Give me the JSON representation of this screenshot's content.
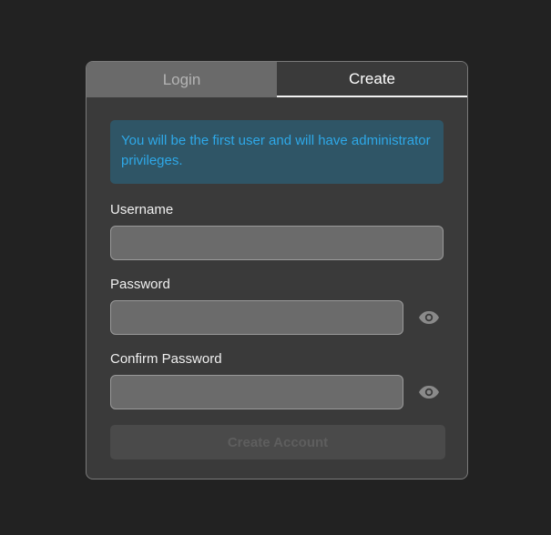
{
  "tabs": {
    "login": "Login",
    "create": "Create",
    "active": "create"
  },
  "alert": {
    "message": "You will be the first user and will have administrator privileges."
  },
  "fields": {
    "username_label": "Username",
    "username_value": "",
    "password_label": "Password",
    "password_value": "",
    "confirm_label": "Confirm Password",
    "confirm_value": ""
  },
  "icons": {
    "password_toggle": "eye-icon",
    "confirm_toggle": "eye-icon"
  },
  "submit": {
    "label": "Create Account",
    "enabled": false
  },
  "colors": {
    "alert_text": "#2ea8e8",
    "alert_bg": "#2f5566"
  }
}
